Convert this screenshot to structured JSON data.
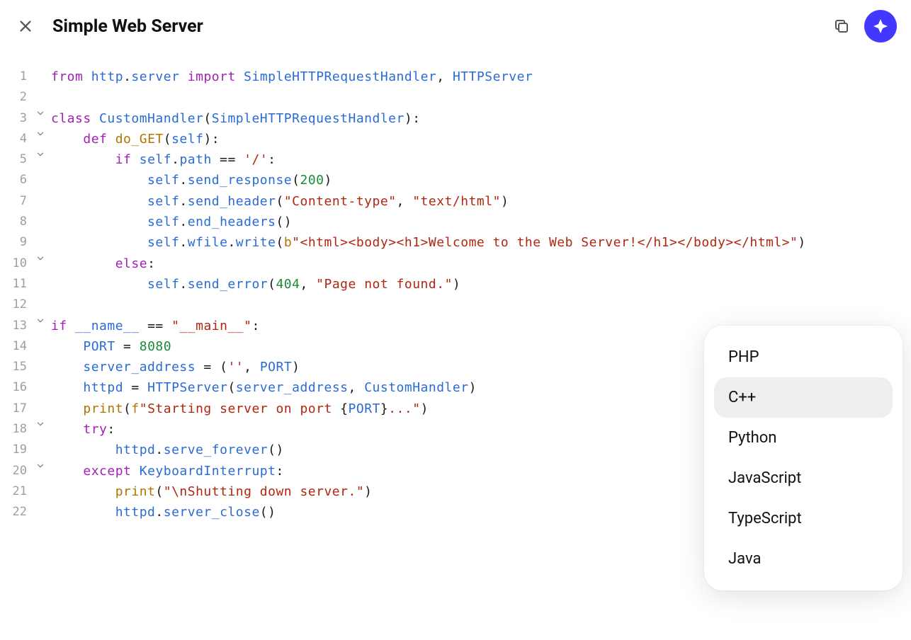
{
  "title": "Simple Web Server",
  "icons": {
    "close": "close-icon",
    "copy": "copy-icon",
    "diamond": "diamond-sparkle-icon"
  },
  "lang_menu": {
    "items": [
      "PHP",
      "C++",
      "Python",
      "JavaScript",
      "TypeScript",
      "Java"
    ],
    "hovered_index": 1
  },
  "code": {
    "lines": [
      {
        "n": 1,
        "fold": false,
        "tokens": [
          [
            "kw",
            "from"
          ],
          [
            "op",
            " "
          ],
          [
            "nm",
            "http"
          ],
          [
            "op",
            "."
          ],
          [
            "nm",
            "server"
          ],
          [
            "op",
            " "
          ],
          [
            "kw",
            "import"
          ],
          [
            "op",
            " "
          ],
          [
            "nm",
            "SimpleHTTPRequestHandler"
          ],
          [
            "op",
            ", "
          ],
          [
            "nm",
            "HTTPServer"
          ]
        ]
      },
      {
        "n": 2,
        "fold": false,
        "tokens": []
      },
      {
        "n": 3,
        "fold": true,
        "tokens": [
          [
            "kw",
            "class"
          ],
          [
            "op",
            " "
          ],
          [
            "nm",
            "CustomHandler"
          ],
          [
            "op",
            "("
          ],
          [
            "nm",
            "SimpleHTTPRequestHandler"
          ],
          [
            "op",
            "):"
          ]
        ]
      },
      {
        "n": 4,
        "fold": true,
        "tokens": [
          [
            "op",
            "    "
          ],
          [
            "kw",
            "def"
          ],
          [
            "op",
            " "
          ],
          [
            "fn",
            "do_GET"
          ],
          [
            "op",
            "("
          ],
          [
            "nm",
            "self"
          ],
          [
            "op",
            "):"
          ]
        ]
      },
      {
        "n": 5,
        "fold": true,
        "tokens": [
          [
            "op",
            "        "
          ],
          [
            "kw",
            "if"
          ],
          [
            "op",
            " "
          ],
          [
            "nm",
            "self"
          ],
          [
            "op",
            "."
          ],
          [
            "nm",
            "path"
          ],
          [
            "op",
            " == "
          ],
          [
            "str",
            "'/'"
          ],
          [
            "op",
            ":"
          ]
        ]
      },
      {
        "n": 6,
        "fold": false,
        "tokens": [
          [
            "op",
            "            "
          ],
          [
            "nm",
            "self"
          ],
          [
            "op",
            "."
          ],
          [
            "nm",
            "send_response"
          ],
          [
            "op",
            "("
          ],
          [
            "num",
            "200"
          ],
          [
            "op",
            ")"
          ]
        ]
      },
      {
        "n": 7,
        "fold": false,
        "tokens": [
          [
            "op",
            "            "
          ],
          [
            "nm",
            "self"
          ],
          [
            "op",
            "."
          ],
          [
            "nm",
            "send_header"
          ],
          [
            "op",
            "("
          ],
          [
            "str",
            "\"Content-type\""
          ],
          [
            "op",
            ", "
          ],
          [
            "str",
            "\"text/html\""
          ],
          [
            "op",
            ")"
          ]
        ]
      },
      {
        "n": 8,
        "fold": false,
        "tokens": [
          [
            "op",
            "            "
          ],
          [
            "nm",
            "self"
          ],
          [
            "op",
            "."
          ],
          [
            "nm",
            "end_headers"
          ],
          [
            "op",
            "()"
          ]
        ]
      },
      {
        "n": 9,
        "fold": false,
        "tokens": [
          [
            "op",
            "            "
          ],
          [
            "nm",
            "self"
          ],
          [
            "op",
            "."
          ],
          [
            "nm",
            "wfile"
          ],
          [
            "op",
            "."
          ],
          [
            "nm",
            "write"
          ],
          [
            "op",
            "("
          ],
          [
            "fn",
            "b"
          ],
          [
            "str",
            "\"<html><body><h1>Welcome to the Web Server!</h1></body></html>\""
          ],
          [
            "op",
            ")"
          ]
        ]
      },
      {
        "n": 10,
        "fold": true,
        "tokens": [
          [
            "op",
            "        "
          ],
          [
            "kw",
            "else"
          ],
          [
            "op",
            ":"
          ]
        ]
      },
      {
        "n": 11,
        "fold": false,
        "tokens": [
          [
            "op",
            "            "
          ],
          [
            "nm",
            "self"
          ],
          [
            "op",
            "."
          ],
          [
            "nm",
            "send_error"
          ],
          [
            "op",
            "("
          ],
          [
            "num",
            "404"
          ],
          [
            "op",
            ", "
          ],
          [
            "str",
            "\"Page not found.\""
          ],
          [
            "op",
            ")"
          ]
        ]
      },
      {
        "n": 12,
        "fold": false,
        "tokens": []
      },
      {
        "n": 13,
        "fold": true,
        "tokens": [
          [
            "kw",
            "if"
          ],
          [
            "op",
            " "
          ],
          [
            "nm",
            "__name__"
          ],
          [
            "op",
            " == "
          ],
          [
            "str",
            "\"__main__\""
          ],
          [
            "op",
            ":"
          ]
        ]
      },
      {
        "n": 14,
        "fold": false,
        "tokens": [
          [
            "op",
            "    "
          ],
          [
            "nm",
            "PORT"
          ],
          [
            "op",
            " = "
          ],
          [
            "num",
            "8080"
          ]
        ]
      },
      {
        "n": 15,
        "fold": false,
        "tokens": [
          [
            "op",
            "    "
          ],
          [
            "nm",
            "server_address"
          ],
          [
            "op",
            " = ("
          ],
          [
            "str",
            "''"
          ],
          [
            "op",
            ", "
          ],
          [
            "nm",
            "PORT"
          ],
          [
            "op",
            ")"
          ]
        ]
      },
      {
        "n": 16,
        "fold": false,
        "tokens": [
          [
            "op",
            "    "
          ],
          [
            "nm",
            "httpd"
          ],
          [
            "op",
            " = "
          ],
          [
            "nm",
            "HTTPServer"
          ],
          [
            "op",
            "("
          ],
          [
            "nm",
            "server_address"
          ],
          [
            "op",
            ", "
          ],
          [
            "nm",
            "CustomHandler"
          ],
          [
            "op",
            ")"
          ]
        ]
      },
      {
        "n": 17,
        "fold": false,
        "tokens": [
          [
            "op",
            "    "
          ],
          [
            "fn",
            "print"
          ],
          [
            "op",
            "("
          ],
          [
            "fn",
            "f"
          ],
          [
            "str",
            "\"Starting server on port "
          ],
          [
            "op",
            "{"
          ],
          [
            "nm",
            "PORT"
          ],
          [
            "op",
            "}"
          ],
          [
            "str",
            "...\""
          ],
          [
            "op",
            ")"
          ]
        ]
      },
      {
        "n": 18,
        "fold": true,
        "tokens": [
          [
            "op",
            "    "
          ],
          [
            "kw",
            "try"
          ],
          [
            "op",
            ":"
          ]
        ]
      },
      {
        "n": 19,
        "fold": false,
        "tokens": [
          [
            "op",
            "        "
          ],
          [
            "nm",
            "httpd"
          ],
          [
            "op",
            "."
          ],
          [
            "nm",
            "serve_forever"
          ],
          [
            "op",
            "()"
          ]
        ]
      },
      {
        "n": 20,
        "fold": true,
        "tokens": [
          [
            "op",
            "    "
          ],
          [
            "kw",
            "except"
          ],
          [
            "op",
            " "
          ],
          [
            "nm",
            "KeyboardInterrupt"
          ],
          [
            "op",
            ":"
          ]
        ]
      },
      {
        "n": 21,
        "fold": false,
        "tokens": [
          [
            "op",
            "        "
          ],
          [
            "fn",
            "print"
          ],
          [
            "op",
            "("
          ],
          [
            "str",
            "\"\\nShutting down server.\""
          ],
          [
            "op",
            ")"
          ]
        ]
      },
      {
        "n": 22,
        "fold": false,
        "tokens": [
          [
            "op",
            "        "
          ],
          [
            "nm",
            "httpd"
          ],
          [
            "op",
            "."
          ],
          [
            "nm",
            "server_close"
          ],
          [
            "op",
            "()"
          ]
        ]
      }
    ]
  }
}
